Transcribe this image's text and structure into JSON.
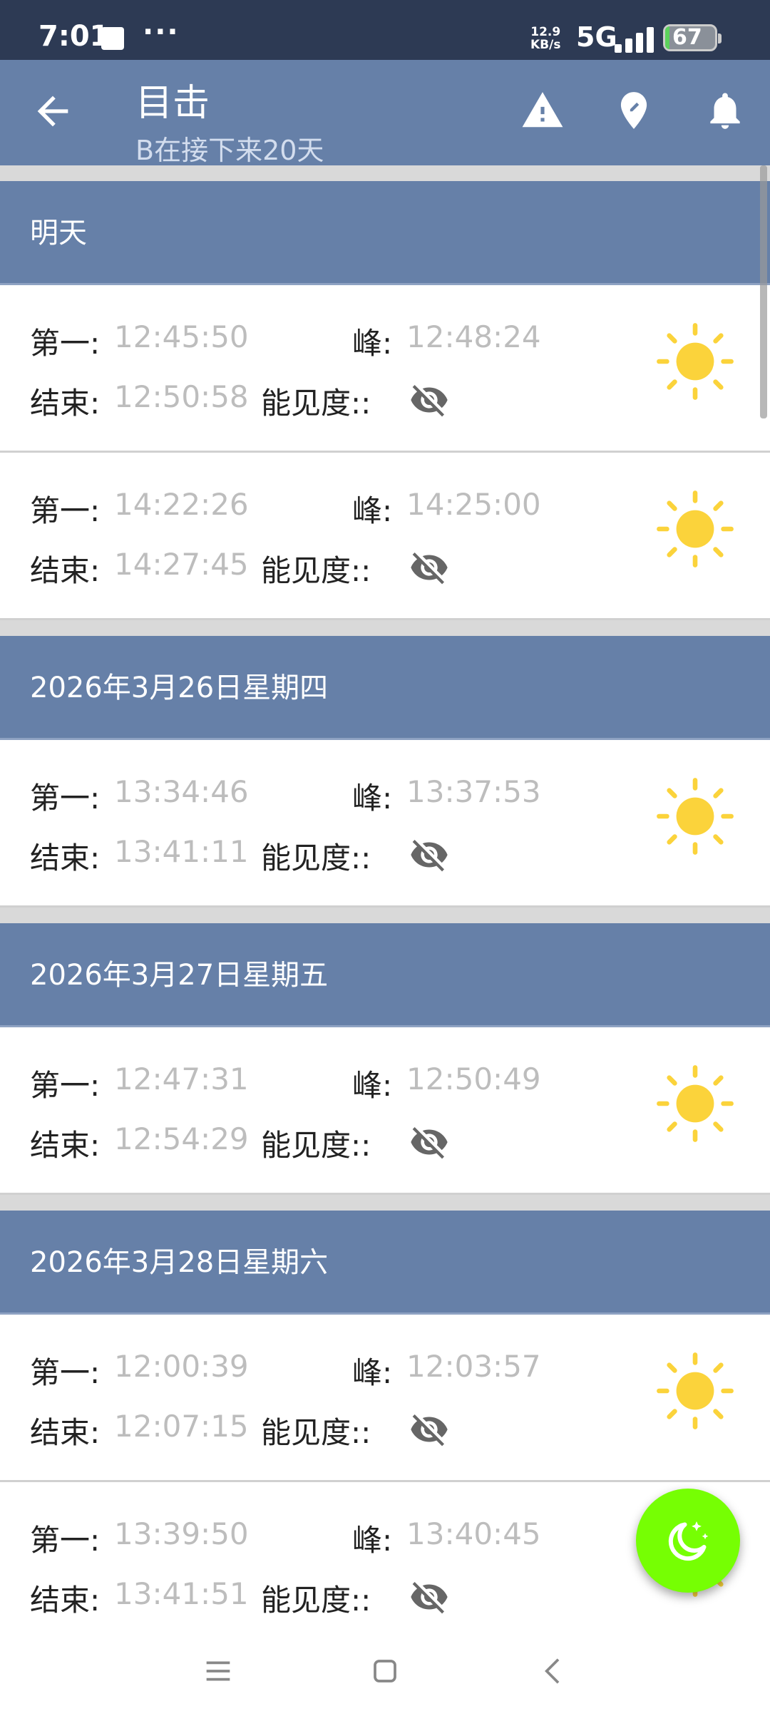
{
  "status_bar": {
    "time": "7:01",
    "dots": "···",
    "net_speed_value": "12.9",
    "net_speed_unit": "KB/s",
    "network": "5G",
    "battery": "67"
  },
  "header": {
    "title": "目击",
    "subtitle": "B在接下来20天"
  },
  "labels": {
    "first": "第一:",
    "peak": "峰:",
    "end": "结束:",
    "visibility": "能见度::"
  },
  "colors": {
    "header_bg": "#6680a8",
    "sun": "#fbd33b",
    "fab": "#76ff03",
    "value_text": "#bdbdbd"
  },
  "groups": [
    {
      "date": "明天",
      "events": [
        {
          "first": "12:45:50",
          "peak": "12:48:24",
          "end": "12:50:58",
          "visibility_icon": "eye-off-icon",
          "weather_icon": "sun-icon"
        },
        {
          "first": "14:22:26",
          "peak": "14:25:00",
          "end": "14:27:45",
          "visibility_icon": "eye-off-icon",
          "weather_icon": "sun-icon"
        }
      ]
    },
    {
      "date": "2026年3月26日星期四",
      "events": [
        {
          "first": "13:34:46",
          "peak": "13:37:53",
          "end": "13:41:11",
          "visibility_icon": "eye-off-icon",
          "weather_icon": "sun-icon"
        }
      ]
    },
    {
      "date": "2026年3月27日星期五",
      "events": [
        {
          "first": "12:47:31",
          "peak": "12:50:49",
          "end": "12:54:29",
          "visibility_icon": "eye-off-icon",
          "weather_icon": "sun-icon"
        }
      ]
    },
    {
      "date": "2026年3月28日星期六",
      "events": [
        {
          "first": "12:00:39",
          "peak": "12:03:57",
          "end": "12:07:15",
          "visibility_icon": "eye-off-icon",
          "weather_icon": "sun-icon"
        },
        {
          "first": "13:39:50",
          "peak": "13:40:45",
          "end": "13:41:51",
          "visibility_icon": "eye-off-icon",
          "weather_icon": "sun-icon"
        }
      ]
    }
  ]
}
